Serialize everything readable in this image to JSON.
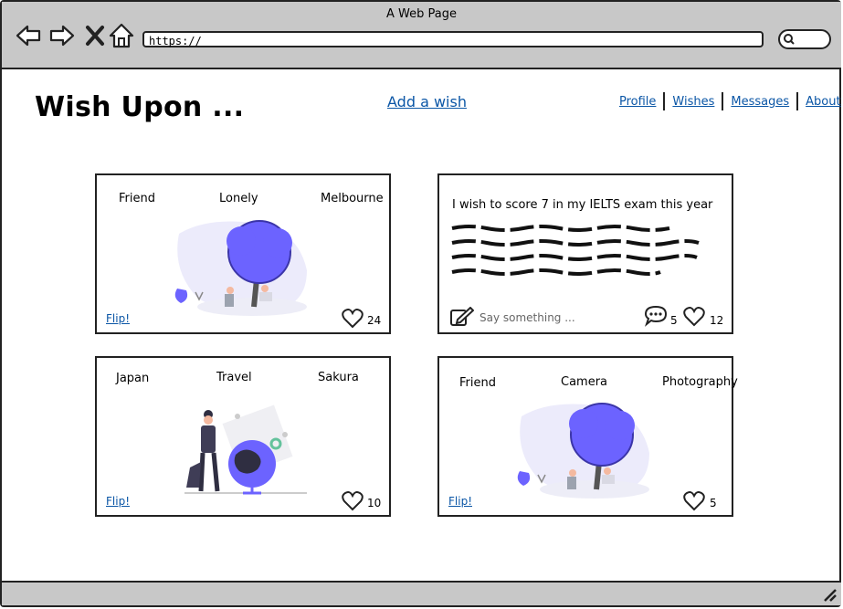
{
  "window": {
    "title": "A Web Page",
    "url": "https://"
  },
  "header": {
    "logo": "Wish Upon ...",
    "add_wish": "Add a wish",
    "nav": [
      "Profile",
      "Wishes",
      "Messages",
      "About"
    ]
  },
  "cards": [
    {
      "tags": [
        "Friend",
        "Lonely",
        "Melbourne"
      ],
      "flip": "Flip!",
      "likes": "24",
      "illustration": "tree-illustration"
    },
    {
      "text": "I wish to score 7 in my IELTS exam this year",
      "comment_placeholder": "Say something ...",
      "comments": "5",
      "likes": "12"
    },
    {
      "tags": [
        "Japan",
        "Travel",
        "Sakura"
      ],
      "flip": "Flip!",
      "likes": "10",
      "illustration": "globe-traveler-illustration"
    },
    {
      "tags": [
        "Friend",
        "Camera",
        "Photography"
      ],
      "flip": "Flip!",
      "likes": "5",
      "illustration": "tree-illustration"
    }
  ],
  "colors": {
    "accent": "#6c63ff",
    "link": "#0b56a6",
    "chrome": "#c8c8c8"
  },
  "icons": [
    "back-arrow-icon",
    "forward-arrow-icon",
    "close-icon",
    "home-icon",
    "search-icon",
    "heart-icon",
    "comment-icon",
    "pencil-icon",
    "resize-icon"
  ]
}
